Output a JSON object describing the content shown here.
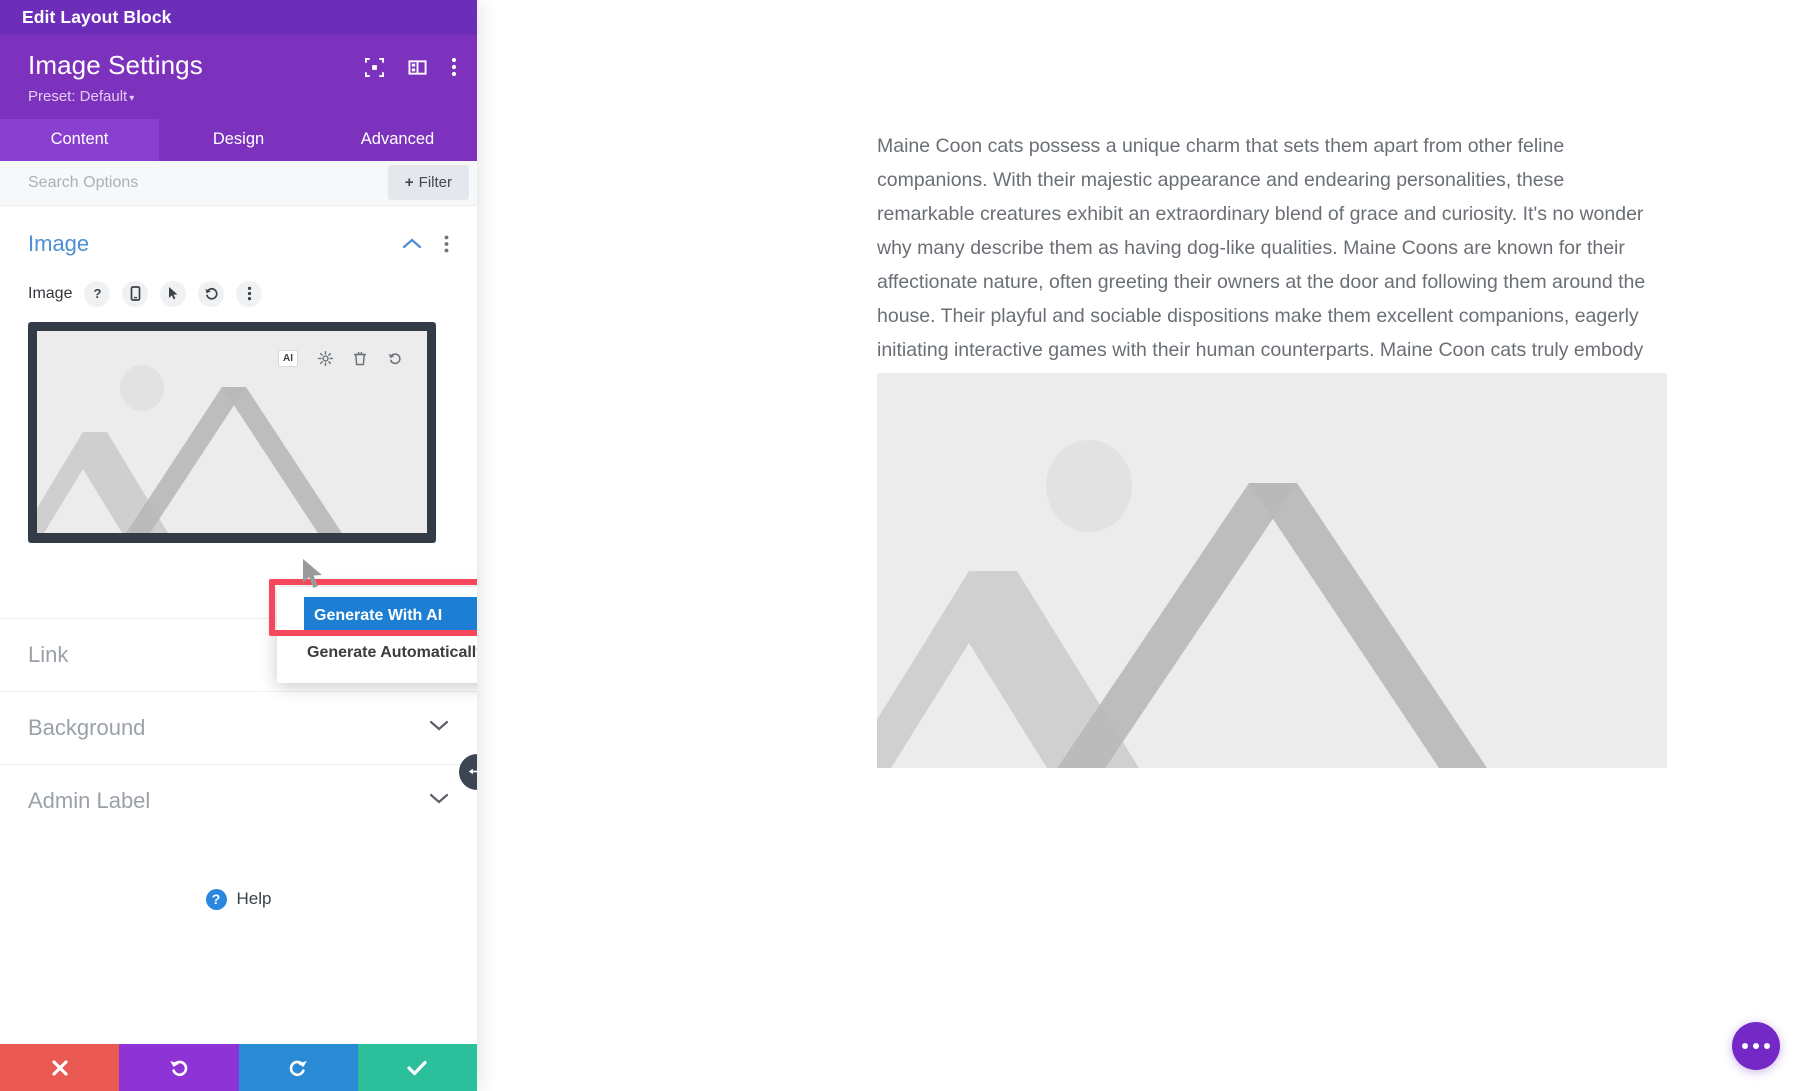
{
  "window": {
    "topbar_title": "Edit Layout Block"
  },
  "sidebar": {
    "title": "Image Settings",
    "preset_label": "Preset: Default",
    "header_icons": [
      {
        "name": "focus-icon"
      },
      {
        "name": "panel-layout-icon"
      },
      {
        "name": "more-vertical-icon"
      }
    ],
    "tabs": [
      {
        "label": "Content",
        "active": true
      },
      {
        "label": "Design",
        "active": false
      },
      {
        "label": "Advanced",
        "active": false
      }
    ],
    "search": {
      "placeholder": "Search Options",
      "value": "",
      "filter_label": "Filter",
      "filter_plus": "+"
    },
    "image_section": {
      "title": "Image",
      "field_label": "Image",
      "field_icons": [
        "help-icon",
        "responsive-icon",
        "hover-icon",
        "reset-icon",
        "more-options-icon"
      ]
    },
    "ai_toolbar": {
      "badge": "AI",
      "icons": [
        "ai-badge-icon",
        "settings-gear-icon",
        "delete-trash-icon",
        "undo-icon"
      ]
    },
    "ai_menu": {
      "items": [
        {
          "label": "Generate With AI",
          "selected": true
        },
        {
          "label": "Generate Automatically",
          "selected": false
        }
      ]
    },
    "accordions": [
      {
        "label": "Link"
      },
      {
        "label": "Background"
      },
      {
        "label": "Admin Label"
      }
    ],
    "help": {
      "label": "Help",
      "glyph": "?"
    },
    "actions": [
      {
        "name": "cancel-action",
        "color": "#ea5a53",
        "icon": "close-icon"
      },
      {
        "name": "undo-action",
        "color": "#8e33d6",
        "icon": "undo-icon"
      },
      {
        "name": "redo-action",
        "color": "#2a8ad4",
        "icon": "redo-icon"
      },
      {
        "name": "save-action",
        "color": "#2bbf9b",
        "icon": "check-icon"
      }
    ]
  },
  "main": {
    "paragraph": "Maine Coon cats possess a unique charm that sets them apart from other feline companions. With their majestic appearance and endearing personalities, these remarkable creatures exhibit an extraordinary blend of grace and curiosity. It's no wonder why many describe them as having dog-like qualities. Maine Coons are known for their affectionate nature, often greeting their owners at the door and following them around the house. Their playful and sociable dispositions make them excellent companions, eagerly initiating interactive games with their human counterparts. Maine Coon cats truly embody the best of both worlds, captivating hearts with their dog-like charm and leaving a lasting pawprint on our lives."
  },
  "colors": {
    "brand_purple": "#7d32bd",
    "topbar_purple": "#6c2eb9",
    "accent_blue": "#1c7fd4",
    "highlight_red": "#f5485b",
    "section_blue": "#4b8fd4"
  }
}
